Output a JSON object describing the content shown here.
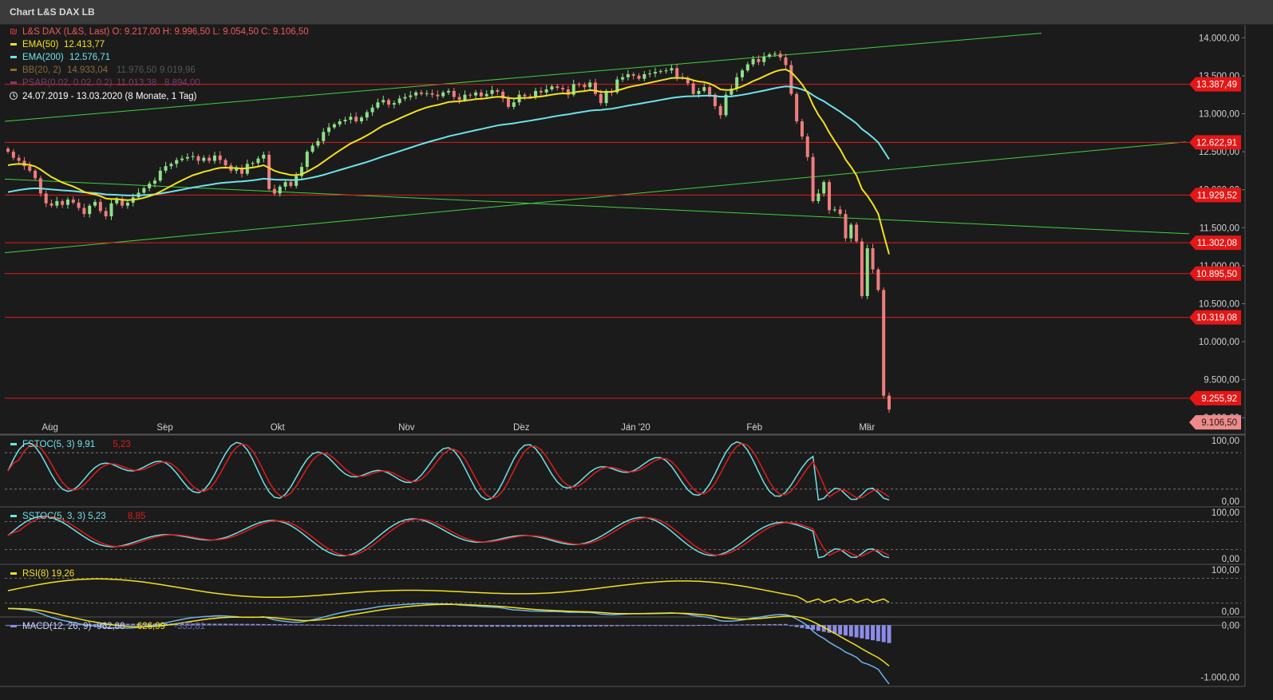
{
  "window": {
    "title": "Chart L&S DAX LB"
  },
  "legend": {
    "main": {
      "name": "L&S DAX (L&S, Last)",
      "ohlc": "O: 9.217,00  H: 9.996,50  L: 9.054,50  C: 9.106,50"
    },
    "ema50": {
      "name": "EMA(50)",
      "value": "12.413,77",
      "color": "#f2e21c"
    },
    "ema200": {
      "name": "EMA(200)",
      "value": "12.576,71",
      "color": "#6fe3ea"
    },
    "bb": {
      "name": "BB(20, 2)",
      "value1": "14.933,04",
      "value2": "11.976,50",
      "value3": "9.019,96"
    },
    "psar": {
      "name": "PSAR(0.02, 0.02, 0.2)",
      "value1": "11.013,38",
      "value2": "8.894,00"
    },
    "range": "24.07.2019 - 13.03.2020  (8 Monate, 1 Tag)"
  },
  "x_axis": {
    "months": [
      {
        "label": "Aug",
        "pos": 0.038
      },
      {
        "label": "Sep",
        "pos": 0.135
      },
      {
        "label": "Okt",
        "pos": 0.231
      },
      {
        "label": "Nov",
        "pos": 0.339
      },
      {
        "label": "Dez",
        "pos": 0.436
      },
      {
        "label": "Jan '20",
        "pos": 0.527
      },
      {
        "label": "Feb",
        "pos": 0.633
      },
      {
        "label": "Mär",
        "pos": 0.728
      }
    ]
  },
  "y_ticks_main": [
    "14.000,00",
    "13.500,00",
    "13.000,00",
    "12.500,00",
    "12.000,00",
    "11.500,00",
    "11.000,00",
    "10.500,00",
    "10.000,00",
    "9.500,00",
    "9.000,00"
  ],
  "y_tick_values": [
    14000,
    13500,
    13000,
    12500,
    12000,
    11500,
    11000,
    10500,
    10000,
    9500,
    9000
  ],
  "horizontal_levels": [
    {
      "value": 13387.49,
      "label": "13.387,49"
    },
    {
      "value": 12622.91,
      "label": "12.622,91"
    },
    {
      "value": 11929.52,
      "label": "11.929,52"
    },
    {
      "value": 11302.08,
      "label": "11.302,08"
    },
    {
      "value": 10895.5,
      "label": "10.895,50"
    },
    {
      "value": 10319.08,
      "label": "10.319,08"
    },
    {
      "value": 9255.92,
      "label": "9.255,92"
    }
  ],
  "last_price": {
    "value": 9106.5,
    "label": "9.106,50"
  },
  "subpanels": {
    "fstoc": {
      "name": "FSTOC(5, 3)",
      "v1": "9,91",
      "v2": "5,23",
      "ticks": [
        "100,00",
        "0,00"
      ]
    },
    "sstoc": {
      "name": "SSTOC(5, 3, 3)",
      "v1": "5,23",
      "v2": "8,85",
      "ticks": [
        "100,00",
        "0,00"
      ]
    },
    "rsi": {
      "name": "RSI(8)",
      "v1": "19,26",
      "ticks": [
        "100,00",
        "0,00"
      ]
    },
    "macd": {
      "name": "MACD(12, 26, 9)",
      "v1": "-962,80",
      "v2": "-626,99",
      "v3": "-335,81",
      "ticks": [
        "0,00",
        "-1.000,00"
      ]
    }
  },
  "colors": {
    "up": "#8fe08a",
    "down": "#ef7d7d",
    "level": "#e01b1b",
    "trend": "#3fd13f",
    "ema50": "#f2e21c",
    "ema200": "#6fe3ea",
    "stoc_k": "#6fe3ea",
    "stoc_d": "#e01b1b",
    "rsi": "#f2e21c",
    "macd_hist": "#8c8ce8"
  },
  "chart_data": {
    "type": "candlestick",
    "title": "Chart L&S DAX LB",
    "period": "24.07.2019 - 13.03.2020",
    "ylim": [
      8950,
      14150
    ],
    "series": [
      {
        "name": "L&S DAX (L&S, Last)",
        "closes": [
          12500,
          12420,
          12380,
          12310,
          12250,
          12150,
          11950,
          11820,
          11790,
          11850,
          11800,
          11870,
          11830,
          11760,
          11680,
          11790,
          11840,
          11720,
          11650,
          11820,
          11880,
          11790,
          11830,
          11900,
          11960,
          12020,
          12080,
          12120,
          12250,
          12310,
          12340,
          12390,
          12410,
          12430,
          12440,
          12380,
          12420,
          12380,
          12450,
          12390,
          12320,
          12250,
          12280,
          12210,
          12340,
          12350,
          12410,
          12460,
          12010,
          11950,
          12040,
          12100,
          12050,
          12180,
          12300,
          12500,
          12580,
          12640,
          12760,
          12820,
          12860,
          12900,
          12920,
          12960,
          12900,
          12950,
          13020,
          13080,
          13150,
          13180,
          13120,
          13140,
          13200,
          13220,
          13240,
          13280,
          13260,
          13270,
          13250,
          13230,
          13280,
          13300,
          13220,
          13180,
          13250,
          13240,
          13280,
          13230,
          13260,
          13310,
          13290,
          13200,
          13090,
          13150,
          13250,
          13230,
          13220,
          13300,
          13280,
          13320,
          13360,
          13340,
          13320,
          13250,
          13390,
          13380,
          13350,
          13410,
          13260,
          13140,
          13300,
          13280,
          13450,
          13480,
          13520,
          13500,
          13460,
          13520,
          13530,
          13550,
          13560,
          13570,
          13600,
          13480,
          13470,
          13400,
          13260,
          13300,
          13350,
          13250,
          13100,
          12980,
          13250,
          13330,
          13480,
          13570,
          13650,
          13720,
          13680,
          13750,
          13780,
          13790,
          13740,
          13640,
          13260,
          12900,
          12700,
          12430,
          11850,
          11950,
          12100,
          11730,
          11740,
          11680,
          11360,
          11540,
          11320,
          10600,
          11230,
          10950,
          10680,
          9290,
          9106.5
        ]
      },
      {
        "name": "EMA(50)",
        "value": 12413.77
      },
      {
        "name": "EMA(200)",
        "value": 12576.71
      }
    ],
    "indicators": {
      "FSTOC(5, 3)": [
        9.91,
        5.23
      ],
      "SSTOC(5, 3, 3)": [
        5.23,
        8.85
      ],
      "RSI(8)": [
        19.26
      ],
      "MACD(12, 26, 9)": [
        -962.8,
        -626.99,
        -335.81
      ]
    },
    "grid": false
  }
}
